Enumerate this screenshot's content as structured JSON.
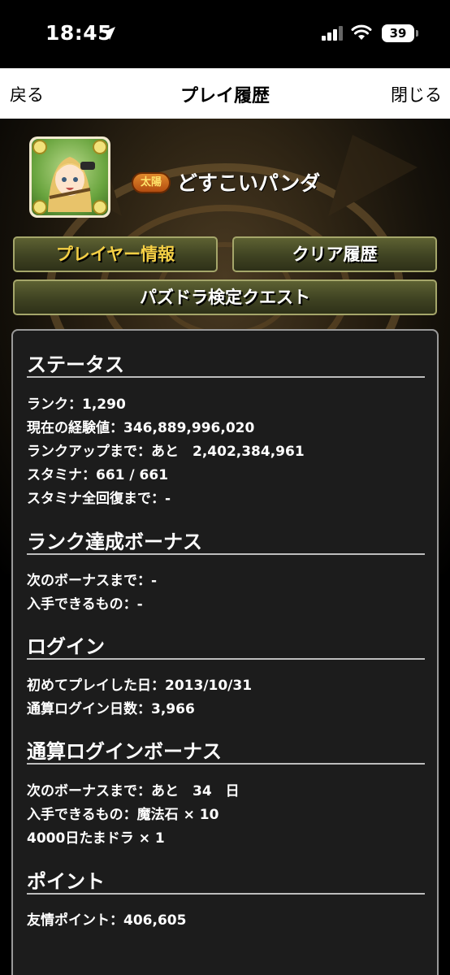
{
  "status_bar": {
    "time": "18:45",
    "battery": "39"
  },
  "nav": {
    "back": "戻る",
    "title": "プレイ履歴",
    "close": "閉じる"
  },
  "player": {
    "badge": "太陽",
    "name": "どすこいパンダ"
  },
  "buttons": {
    "player_info": "プレイヤー情報",
    "clear_history": "クリア履歴",
    "quest": "パズドラ検定クエスト"
  },
  "sections": {
    "status": {
      "title": "ステータス",
      "rows": [
        "ランク：1,290",
        "現在の経験値：346,889,996,020",
        "ランクアップまで：あと　2,402,384,961",
        "スタミナ：661 / 661",
        "スタミナ全回復まで：-"
      ]
    },
    "rank_bonus": {
      "title": "ランク達成ボーナス",
      "rows": [
        "次のボーナスまで：-",
        "入手できるもの：-"
      ]
    },
    "login": {
      "title": "ログイン",
      "rows": [
        "初めてプレイした日：2013/10/31",
        "通算ログイン日数：3,966"
      ]
    },
    "login_bonus": {
      "title": "通算ログインボーナス",
      "rows": [
        "次のボーナスまで：あと　34　日",
        "入手できるもの：魔法石 × 10",
        "4000日たまドラ × 1"
      ]
    },
    "points": {
      "title": "ポイント",
      "rows": [
        "友情ポイント：406,605"
      ]
    }
  },
  "colors": {
    "accent_gold": "#f4cf45",
    "button_border": "#a5a66a",
    "panel_bg": "#1c1c1c"
  }
}
